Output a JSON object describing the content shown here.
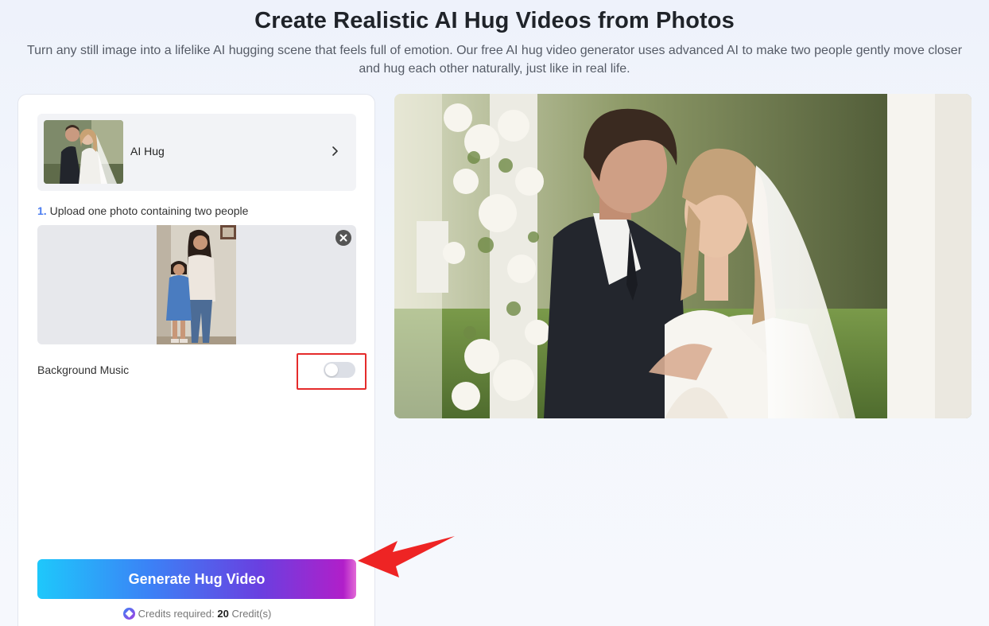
{
  "header": {
    "title": "Create Realistic AI Hug Videos from Photos",
    "subtitle": "Turn any still image into a lifelike AI hugging scene that feels full of emotion. Our free AI hug video generator uses advanced AI to make two people gently move closer and hug each other naturally, just like in real life."
  },
  "template": {
    "label": "AI Hug",
    "icon": "chevron-right-icon"
  },
  "upload": {
    "step_number": "1.",
    "step_text": "Upload one photo containing two people",
    "remove_icon": "close-icon"
  },
  "music": {
    "label": "Background Music",
    "enabled": false
  },
  "generate": {
    "label": "Generate Hug Video"
  },
  "credits": {
    "prefix": "Credits required:",
    "amount": "20",
    "suffix": "Credit(s)"
  },
  "colors": {
    "accent": "#4a7cf0",
    "annotation": "#e52b2b"
  }
}
